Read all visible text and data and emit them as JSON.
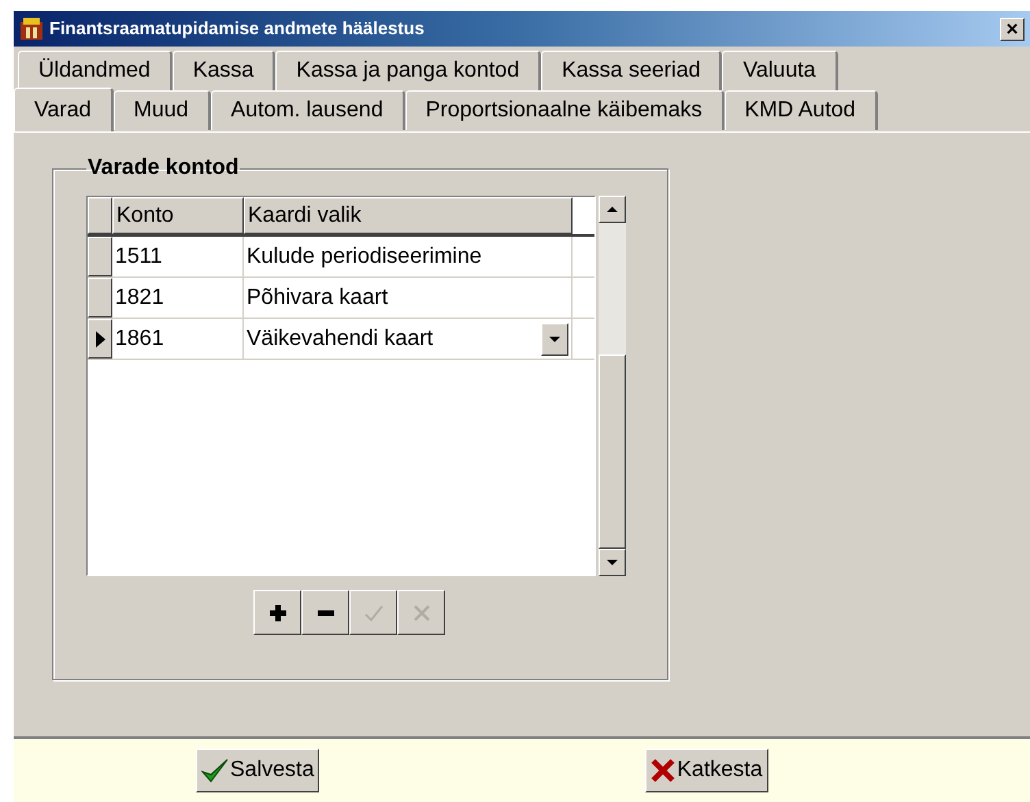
{
  "window": {
    "title": "Finantsraamatupidamise andmete häälestus",
    "close": "×"
  },
  "tab_rows": [
    [
      {
        "label": "Üldandmed",
        "selected": false
      },
      {
        "label": "Kassa",
        "selected": false
      },
      {
        "label": "Kassa ja panga kontod",
        "selected": false
      },
      {
        "label": "Kassa seeriad",
        "selected": false
      },
      {
        "label": "Valuuta",
        "selected": false
      }
    ],
    [
      {
        "label": "Varad",
        "selected": true
      },
      {
        "label": "Muud",
        "selected": false
      },
      {
        "label": "Autom. lausend",
        "selected": false
      },
      {
        "label": "Proportsionaalne käibemaks",
        "selected": false
      },
      {
        "label": "KMD Autod",
        "selected": false
      }
    ]
  ],
  "group": {
    "title": "Varade kontod",
    "table": {
      "columns": [
        "Konto",
        "Kaardi valik"
      ],
      "rows": [
        {
          "cells": [
            "1511",
            "Kulude periodiseerimine"
          ],
          "selected": false
        },
        {
          "cells": [
            "1821",
            "Põhivara kaart"
          ],
          "selected": false
        },
        {
          "cells": [
            "1861",
            "Väikevahendi kaart"
          ],
          "selected": true
        }
      ]
    },
    "navigator": [
      {
        "kind": "add",
        "disabled": false
      },
      {
        "kind": "remove",
        "disabled": false
      },
      {
        "kind": "confirm",
        "disabled": true
      },
      {
        "kind": "cancel",
        "disabled": true
      }
    ]
  },
  "buttons": [
    {
      "kind": "save",
      "label": "Salvesta"
    },
    {
      "kind": "cancel",
      "label": "Katkesta"
    }
  ]
}
